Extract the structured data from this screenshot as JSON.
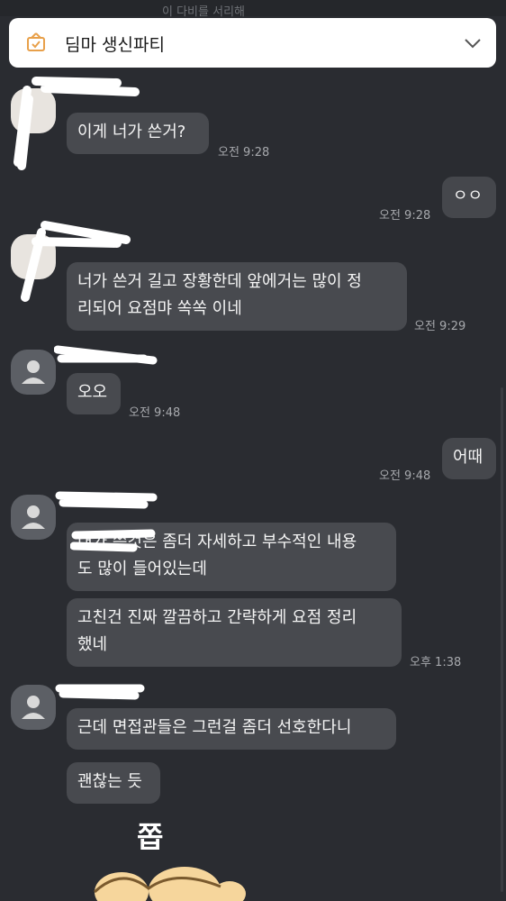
{
  "notice": {
    "title": "딤마 생신파티",
    "icon": "gift-box-icon",
    "expand_icon": "chevron-down-icon"
  },
  "top_strip_text": "이 다비를 서리해",
  "messages": [
    {
      "id": "m1",
      "side": "in",
      "text": "이게 너가 쓴거?",
      "time": "오전 9:28"
    },
    {
      "id": "m2",
      "side": "out",
      "text": "ㅇㅇ",
      "time": "오전 9:28"
    },
    {
      "id": "m3",
      "side": "in",
      "text": "너가 쓴거 길고 장황한데 앞에거는 많이 정\n리되어 요점먀 쏙쏙 이네",
      "time": "오전 9:29"
    },
    {
      "id": "m4",
      "side": "in",
      "text": "오오",
      "time": "오전 9:48"
    },
    {
      "id": "m5",
      "side": "out",
      "text": "어때",
      "time": "오전 9:48"
    },
    {
      "id": "m6",
      "side": "in",
      "text": "내가 쓴것은 좀더 자세하고 부수적인 내용\n도 많이 들어있는데",
      "time": ""
    },
    {
      "id": "m7",
      "side": "in",
      "text": "고친건 진짜 깔끔하고 간략하게 요점 정리\n했네",
      "time": "오후 1:38"
    },
    {
      "id": "m8",
      "side": "in",
      "text": "근데 면접관들은 그런걸 좀더 선호한다니",
      "time": ""
    },
    {
      "id": "m9",
      "side": "in",
      "text": "괜찮는 듯",
      "time": ""
    }
  ],
  "sticker": {
    "text": "쫍",
    "icon": "bear-sticker"
  },
  "colors": {
    "background": "#2a2c31",
    "bubble": "#484a4f",
    "notice_icon": "#e8a04a"
  }
}
